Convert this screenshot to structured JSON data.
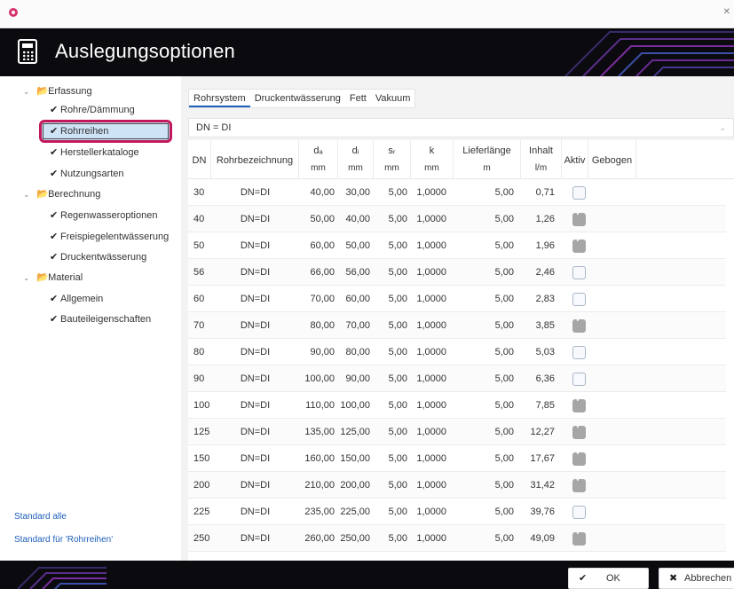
{
  "header": {
    "title": "Auslegungsoptionen"
  },
  "sidebar": {
    "tree": [
      {
        "label": "Erfassung",
        "type": "folder"
      },
      {
        "label": "Rohre/Dämmung",
        "type": "item"
      },
      {
        "label": "Rohrreihen",
        "type": "item",
        "selected": true
      },
      {
        "label": "Herstellerkataloge",
        "type": "item"
      },
      {
        "label": "Nutzungsarten",
        "type": "item"
      },
      {
        "label": "Berechnung",
        "type": "folder"
      },
      {
        "label": "Regenwasseroptionen",
        "type": "item"
      },
      {
        "label": "Freispiegelentwässerung",
        "type": "item"
      },
      {
        "label": "Druckentwässerung",
        "type": "item"
      },
      {
        "label": "Material",
        "type": "folder"
      },
      {
        "label": "Allgemein",
        "type": "item"
      },
      {
        "label": "Bauteileigenschaften",
        "type": "item"
      }
    ],
    "link_all": "Standard alle",
    "link_current": "Standard für 'Rohrreihen'"
  },
  "tabs": [
    "Rohrsystem",
    "Druckentwässerung",
    "Fett",
    "Vakuum"
  ],
  "active_tab": "Rohrsystem",
  "dropdown": {
    "value": "DN = DI"
  },
  "table": {
    "headers": {
      "dn": "DN",
      "name": "Rohrbezeichnung",
      "da": "dₐ",
      "da_unit": "mm",
      "di": "dᵢ",
      "di_unit": "mm",
      "sr": "sᵣ",
      "sr_unit": "mm",
      "k": "k",
      "k_unit": "mm",
      "laenge": "Lieferlänge",
      "laenge_unit": "m",
      "inhalt": "Inhalt",
      "inhalt_unit": "l/m",
      "aktiv": "Aktiv",
      "gebogen": "Gebogen"
    },
    "rows": [
      {
        "dn": "30",
        "name": "DN=DI",
        "da": "40,00",
        "di": "30,00",
        "sr": "5,00",
        "k": "1,0000",
        "laenge": "5,00",
        "inhalt": "0,71",
        "aktiv": false
      },
      {
        "dn": "40",
        "name": "DN=DI",
        "da": "50,00",
        "di": "40,00",
        "sr": "5,00",
        "k": "1,0000",
        "laenge": "5,00",
        "inhalt": "1,26",
        "aktiv": true
      },
      {
        "dn": "50",
        "name": "DN=DI",
        "da": "60,00",
        "di": "50,00",
        "sr": "5,00",
        "k": "1,0000",
        "laenge": "5,00",
        "inhalt": "1,96",
        "aktiv": true
      },
      {
        "dn": "56",
        "name": "DN=DI",
        "da": "66,00",
        "di": "56,00",
        "sr": "5,00",
        "k": "1,0000",
        "laenge": "5,00",
        "inhalt": "2,46",
        "aktiv": false
      },
      {
        "dn": "60",
        "name": "DN=DI",
        "da": "70,00",
        "di": "60,00",
        "sr": "5,00",
        "k": "1,0000",
        "laenge": "5,00",
        "inhalt": "2,83",
        "aktiv": false
      },
      {
        "dn": "70",
        "name": "DN=DI",
        "da": "80,00",
        "di": "70,00",
        "sr": "5,00",
        "k": "1,0000",
        "laenge": "5,00",
        "inhalt": "3,85",
        "aktiv": true
      },
      {
        "dn": "80",
        "name": "DN=DI",
        "da": "90,00",
        "di": "80,00",
        "sr": "5,00",
        "k": "1,0000",
        "laenge": "5,00",
        "inhalt": "5,03",
        "aktiv": false
      },
      {
        "dn": "90",
        "name": "DN=DI",
        "da": "100,00",
        "di": "90,00",
        "sr": "5,00",
        "k": "1,0000",
        "laenge": "5,00",
        "inhalt": "6,36",
        "aktiv": false
      },
      {
        "dn": "100",
        "name": "DN=DI",
        "da": "110,00",
        "di": "100,00",
        "sr": "5,00",
        "k": "1,0000",
        "laenge": "5,00",
        "inhalt": "7,85",
        "aktiv": true
      },
      {
        "dn": "125",
        "name": "DN=DI",
        "da": "135,00",
        "di": "125,00",
        "sr": "5,00",
        "k": "1,0000",
        "laenge": "5,00",
        "inhalt": "12,27",
        "aktiv": true
      },
      {
        "dn": "150",
        "name": "DN=DI",
        "da": "160,00",
        "di": "150,00",
        "sr": "5,00",
        "k": "1,0000",
        "laenge": "5,00",
        "inhalt": "17,67",
        "aktiv": true
      },
      {
        "dn": "200",
        "name": "DN=DI",
        "da": "210,00",
        "di": "200,00",
        "sr": "5,00",
        "k": "1,0000",
        "laenge": "5,00",
        "inhalt": "31,42",
        "aktiv": true
      },
      {
        "dn": "225",
        "name": "DN=DI",
        "da": "235,00",
        "di": "225,00",
        "sr": "5,00",
        "k": "1,0000",
        "laenge": "5,00",
        "inhalt": "39,76",
        "aktiv": false
      },
      {
        "dn": "250",
        "name": "DN=DI",
        "da": "260,00",
        "di": "250,00",
        "sr": "5,00",
        "k": "1,0000",
        "laenge": "5,00",
        "inhalt": "49,09",
        "aktiv": true
      }
    ]
  },
  "footer": {
    "ok_label": "OK",
    "cancel_label": "Abbrechen"
  },
  "colors": {
    "header_bg": "#0b0b0f",
    "accent": "#c2185b",
    "link": "#1f5fbf",
    "checkbox_on": "#a6a6a6"
  }
}
